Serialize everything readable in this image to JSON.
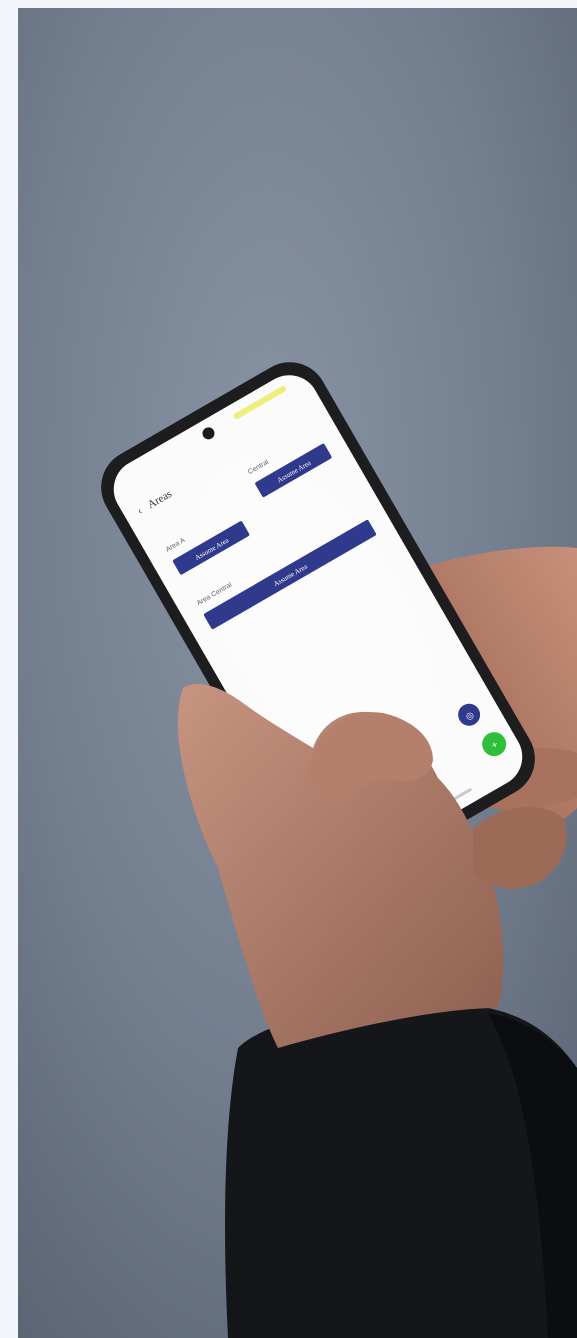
{
  "photo": {
    "subject": "hands holding smartphone",
    "colors": {
      "page_bg": "#f2f6fb",
      "wall": "#7a8595",
      "skin": "#b98470",
      "sleeve": "#14161a",
      "phone_body": "#1d1c1e",
      "screen": "#fbfbfb",
      "accent_button": "#2f3a8c",
      "fab_green": "#2fbf3a",
      "fab_navy": "#2f3a8c",
      "status_bar_bg": "#ebeb5a"
    }
  },
  "screen": {
    "header": {
      "title": "Areas"
    },
    "labels": [
      "Area A",
      "Central",
      "Area Central"
    ],
    "buttons": [
      "Assume Area",
      "Assume Area",
      "Assume Area"
    ]
  }
}
